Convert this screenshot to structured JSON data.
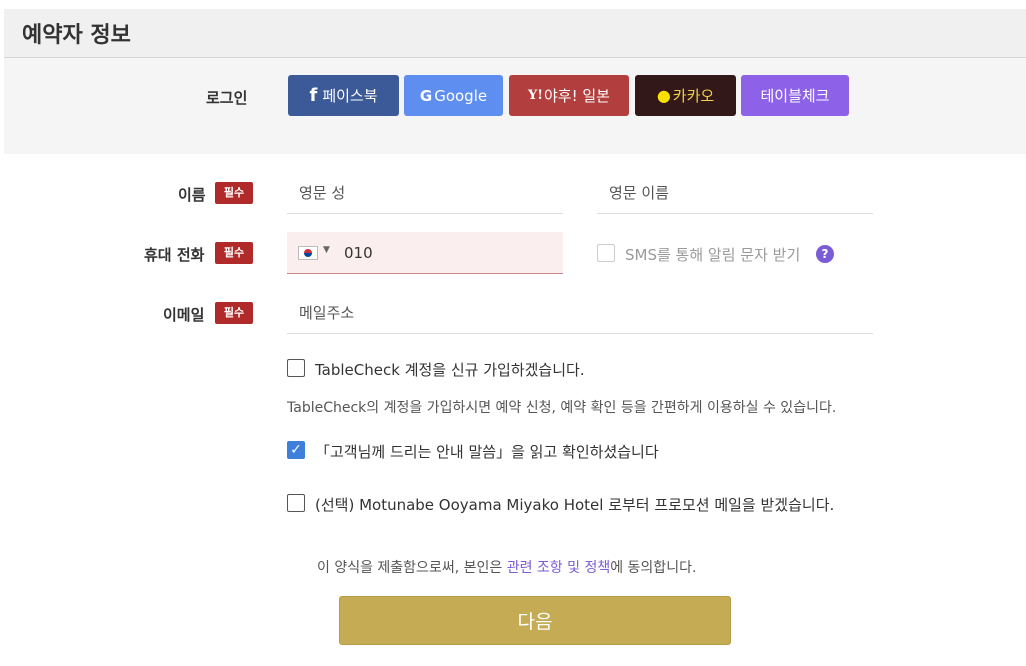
{
  "header": {
    "title": "예약자 정보"
  },
  "login": {
    "label": "로그인",
    "buttons": [
      {
        "label": "페이스북",
        "icon": "facebook-icon",
        "icon_glyph": "f",
        "color": "#3b5a97"
      },
      {
        "label": "Google",
        "icon": "google-icon",
        "icon_glyph": "G",
        "color": "#5e8ef0"
      },
      {
        "label": "야후! 일본",
        "icon": "yahoo-japan-icon",
        "icon_glyph": "Y!",
        "color": "#b33e3e"
      },
      {
        "label": "카카오",
        "icon": "kakao-icon",
        "icon_glyph": "●",
        "color": "#321818"
      },
      {
        "label": "테이블체크",
        "icon": "",
        "icon_glyph": "",
        "color": "#8e62e8"
      }
    ]
  },
  "form": {
    "required_badge": "필수",
    "name": {
      "label": "이름",
      "last_placeholder": "영문 성",
      "first_placeholder": "영문 이름"
    },
    "phone": {
      "label": "휴대 전화",
      "country_flag": "kr-flag-icon",
      "value": "010",
      "sms_label": "SMS를 통해 알림 문자 받기",
      "sms_checked": false,
      "help_glyph": "?"
    },
    "email": {
      "label": "이메일",
      "placeholder": "메일주소"
    },
    "signup": {
      "label": "TableCheck 계정을 신규 가입하겠습니다.",
      "checked": false,
      "helper": "TableCheck의 계정을 가입하시면 예약 신청, 예약 확인 등을 간편하게 이용하실 수 있습니다."
    },
    "notice": {
      "label": "「고객님께 드리는 안내 말씀」을 읽고 확인하셨습니다",
      "checked": true
    },
    "promo": {
      "label": "(선택) Motunabe Ooyama Miyako Hotel 로부터 프로모션 메일을 받겠습니다.",
      "checked": false
    },
    "consent": {
      "prefix": "이 양식을 제출함으로써, 본인은 ",
      "link": "관련 조항 및 정책",
      "suffix": "에 동의합니다."
    },
    "next_label": "다음"
  }
}
